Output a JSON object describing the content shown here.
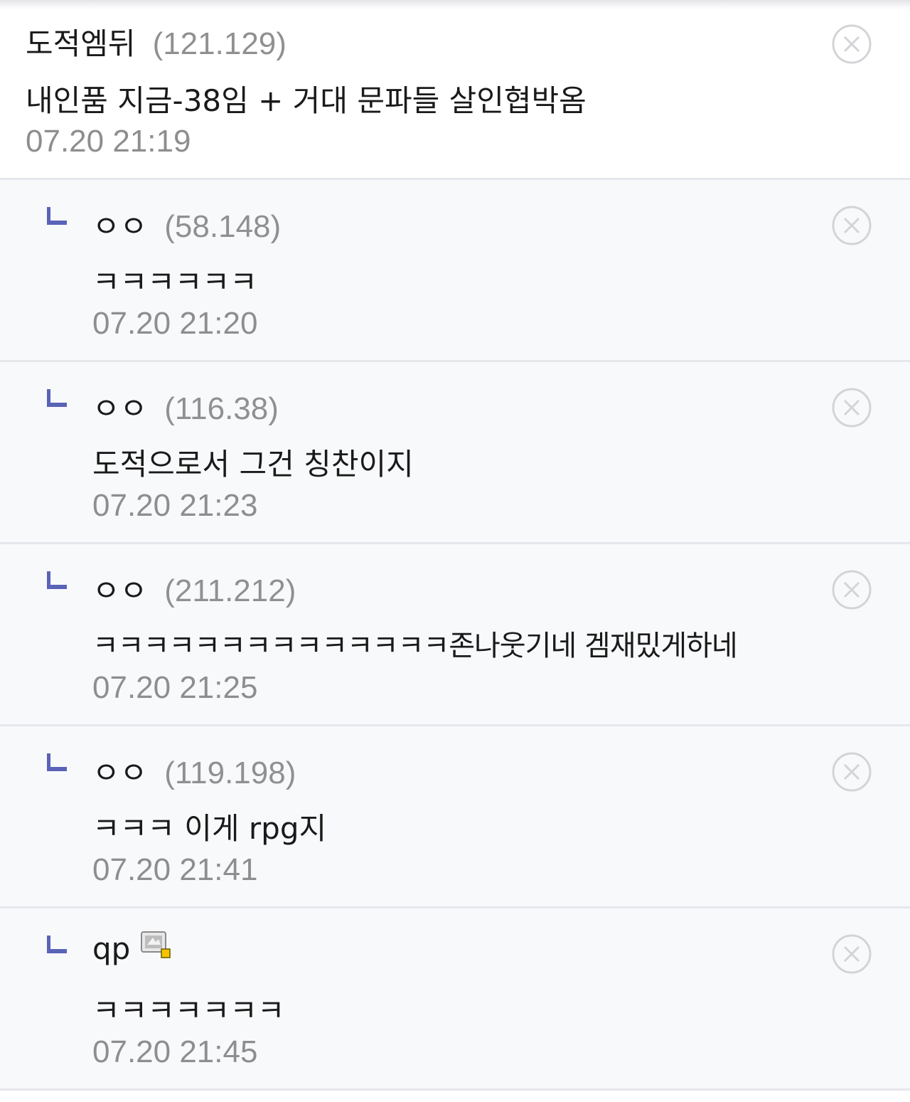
{
  "comments": [
    {
      "nick": "도적엠뒤",
      "ip": "(121.129)",
      "text": "내인품 지금-38임 + 거대 문파들 살인협박옴",
      "date": "07.20 21:19"
    },
    {
      "nick": "ㅇㅇ",
      "ip": "(58.148)",
      "text": "ㅋㅋㅋㅋㅋㅋ",
      "date": "07.20 21:20"
    },
    {
      "nick": "ㅇㅇ",
      "ip": "(116.38)",
      "text": "도적으로서 그건 칭찬이지",
      "date": "07.20 21:23"
    },
    {
      "nick": "ㅇㅇ",
      "ip": "(211.212)",
      "text": "ㅋㅋㅋㅋㅋㅋㅋㅋㅋㅋㅋㅋㅋㅋ존나웃기네 겜재밌게하네",
      "date": "07.20 21:25"
    },
    {
      "nick": "ㅇㅇ",
      "ip": "(119.198)",
      "text": "ㅋㅋㅋ 이게 rpg지",
      "date": "07.20 21:41"
    },
    {
      "nick": "qp",
      "text": "ㅋㅋㅋㅋㅋㅋㅋ",
      "date": "07.20 21:45"
    }
  ],
  "icons": {
    "reply": "reply-arrow-icon",
    "delete": "close-circle-icon",
    "member": "fixed-nick-member-icon"
  },
  "colors": {
    "reply_icon": "#5a63b8",
    "ip_text": "#909090",
    "date_text": "#8e8e8e",
    "reply_background": "#f8f9fb",
    "divider": "#e5e7ec"
  }
}
